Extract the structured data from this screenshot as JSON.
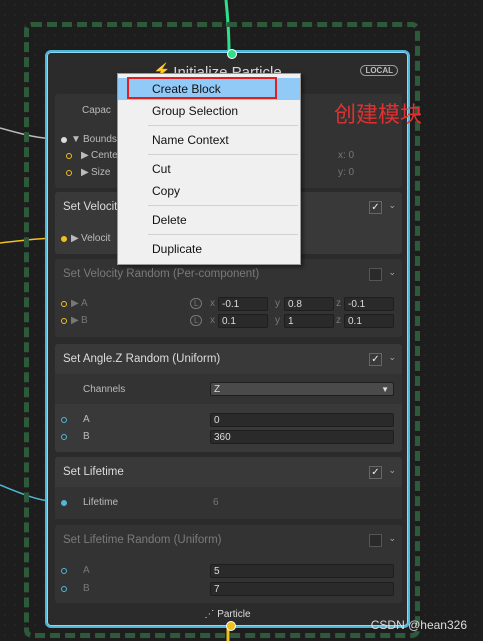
{
  "context": {
    "title": "Initialize Particle",
    "badge": "LOCAL",
    "footer": "Particle"
  },
  "blocks": {
    "capacity": {
      "label": "Capac"
    },
    "bounds": {
      "label": "Bounds",
      "center": "Cente",
      "size": "Size",
      "x": "x: 0",
      "y": "y: 0"
    },
    "set_velocity": {
      "title": "Set Velocit",
      "port_label": "Velocit"
    },
    "velocity_random": {
      "title": "Set Velocity Random (Per-component)",
      "a_label": "A",
      "b_label": "B",
      "space": "L",
      "a": {
        "x": "-0.1",
        "y": "0.8",
        "z": "-0.1"
      },
      "b": {
        "x": "0.1",
        "y": "1",
        "z": "0.1"
      }
    },
    "angle_random": {
      "title": "Set Angle.Z Random (Uniform)",
      "channels_label": "Channels",
      "channels_value": "Z",
      "a_label": "A",
      "a": "0",
      "b_label": "B",
      "b": "360"
    },
    "lifetime": {
      "title": "Set Lifetime",
      "label": "Lifetime",
      "value": "6"
    },
    "lifetime_random": {
      "title": "Set Lifetime Random (Uniform)",
      "a_label": "A",
      "a": "5",
      "b_label": "B",
      "b": "7"
    }
  },
  "menu": {
    "items": [
      "Create Block",
      "Group Selection",
      "Name Context",
      "Cut",
      "Copy",
      "Delete",
      "Duplicate"
    ]
  },
  "annotation": "创建模块",
  "watermark": "CSDN @hean326",
  "colors": {
    "accent_cyan": "#4fb8d8",
    "flow_green": "#2fe08a",
    "highlight_blue": "#91c9f7",
    "annot_red": "#e02020",
    "port_yellow": "#f0c020"
  }
}
